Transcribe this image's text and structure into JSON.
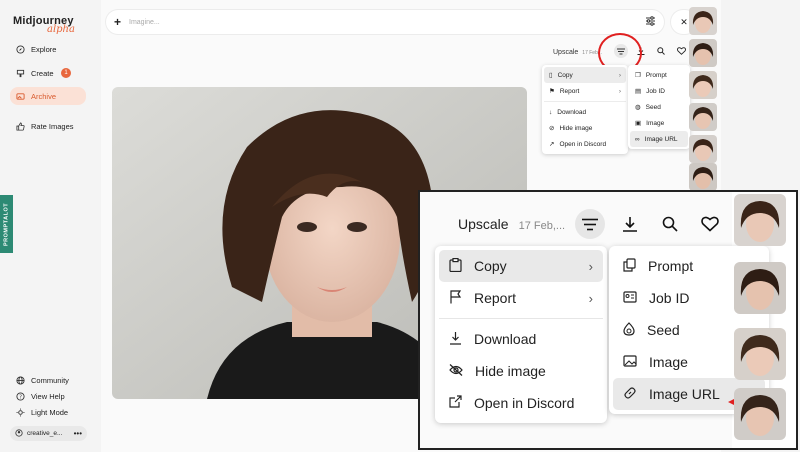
{
  "app": {
    "name": "Midjourney",
    "tagline": "alpha"
  },
  "sidebar": {
    "items": [
      {
        "label": "Explore",
        "icon": "compass-icon"
      },
      {
        "label": "Create",
        "icon": "brush-icon",
        "badge": "1"
      },
      {
        "label": "Archive",
        "icon": "image-icon"
      },
      {
        "label": "Rate Images",
        "icon": "thumbs-up-icon"
      }
    ],
    "bottom": [
      {
        "label": "Community",
        "icon": "globe-icon"
      },
      {
        "label": "View Help",
        "icon": "help-icon"
      },
      {
        "label": "Light Mode",
        "icon": "sun-icon"
      }
    ],
    "user": "creative_e...",
    "prompt_tab": "PROMPTALOT"
  },
  "search": {
    "placeholder": "Imagine..."
  },
  "toolbar": {
    "upscale_label": "Upscale",
    "date_small": "17 Feb...",
    "date_big": "17 Feb,..."
  },
  "menu": {
    "main": [
      {
        "label": "Copy",
        "icon": "clipboard-icon",
        "submenu": true
      },
      {
        "label": "Report",
        "icon": "flag-icon",
        "submenu": true
      },
      {
        "label": "Download",
        "icon": "download-icon"
      },
      {
        "label": "Hide image",
        "icon": "eye-off-icon"
      },
      {
        "label": "Open in Discord",
        "icon": "external-link-icon"
      }
    ],
    "copy_sub": [
      {
        "label": "Prompt",
        "icon": "copy-icon"
      },
      {
        "label": "Job ID",
        "icon": "id-card-icon"
      },
      {
        "label": "Seed",
        "icon": "seed-icon"
      },
      {
        "label": "Image",
        "icon": "image-icon"
      },
      {
        "label": "Image URL",
        "icon": "link-icon"
      }
    ]
  },
  "colors": {
    "accent": "#e8673d",
    "highlight_red": "#e02020",
    "prompt_tab": "#2d8a74"
  }
}
